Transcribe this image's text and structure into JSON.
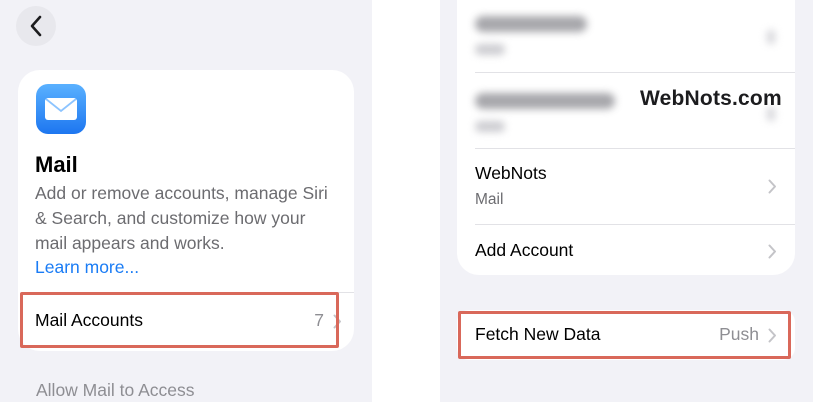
{
  "left": {
    "mail_card": {
      "title": "Mail",
      "description": "Add or remove accounts, manage Siri & Search, and customize how your mail appears and works.",
      "learn_more": "Learn more...",
      "accounts_row": {
        "label": "Mail Accounts",
        "value": "7"
      }
    },
    "section_header": "Allow Mail to Access"
  },
  "right": {
    "accounts": [
      {
        "title": "WebNots",
        "subtitle": "Mail"
      },
      {
        "title": "Add Account"
      }
    ],
    "fetch_row": {
      "label": "Fetch New Data",
      "value": "Push"
    }
  },
  "watermark": "WebNots.com",
  "colors": {
    "highlight": "#d9685a",
    "link": "#1a7cf5",
    "group_background": "#f2f2f7"
  },
  "icons": [
    "chevron-left-icon",
    "mail-app-icon",
    "chevron-right-icon"
  ]
}
